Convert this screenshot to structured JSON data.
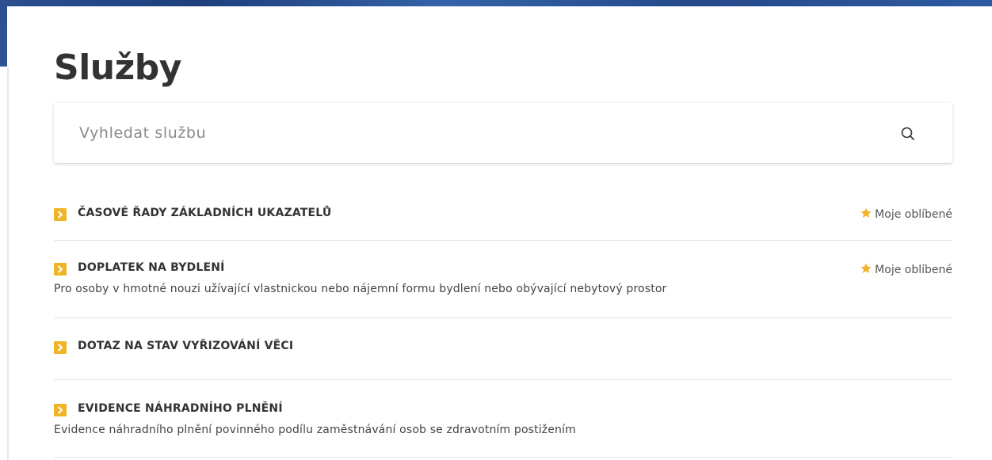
{
  "page": {
    "title": "Služby"
  },
  "search": {
    "placeholder": "Vyhledat službu",
    "icon": "search-icon"
  },
  "favorite_label": "Moje oblíbené",
  "colors": {
    "accent": "#f0b429",
    "header_band": "#2b4f8f",
    "text": "#333333"
  },
  "services": [
    {
      "title": "ČASOVÉ ŘADY ZÁKLADNÍCH UKAZATELŮ",
      "description": "",
      "favorite": "Moje oblíbené"
    },
    {
      "title": "DOPLATEK NA BYDLENÍ",
      "description": "Pro osoby v hmotné nouzi užívající vlastnickou nebo nájemní formu bydlení nebo obývající nebytový prostor",
      "favorite": "Moje oblíbené"
    },
    {
      "title": "DOTAZ NA STAV VYŘIZOVÁNÍ VĚCI",
      "description": "",
      "favorite": ""
    },
    {
      "title": "EVIDENCE NÁHRADNÍHO PLNĚNÍ",
      "description": "Evidence náhradního plnění povinného podílu zaměstnávání osob se zdravotním postižením",
      "favorite": ""
    }
  ]
}
